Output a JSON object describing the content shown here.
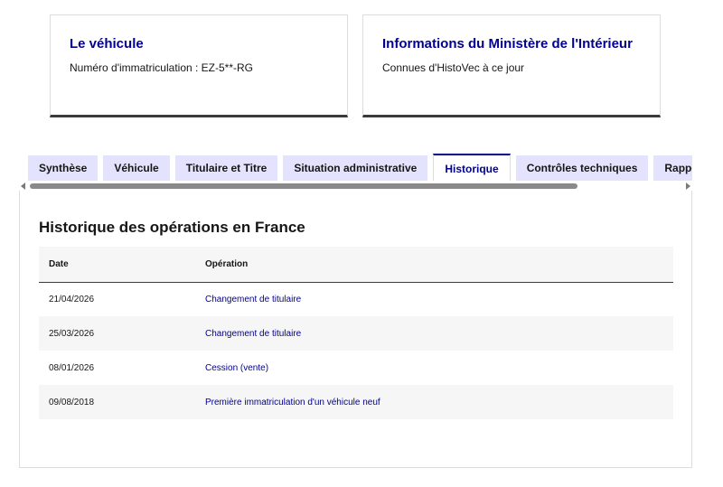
{
  "cards": [
    {
      "title": "Le véhicule",
      "subtitle": "Numéro d'immatriculation : EZ-5**-RG"
    },
    {
      "title": "Informations du Ministère de l'Intérieur",
      "subtitle": "Connues d'HistoVec à ce jour"
    }
  ],
  "tabs": [
    {
      "label": "Synthèse",
      "active": false
    },
    {
      "label": "Véhicule",
      "active": false
    },
    {
      "label": "Titulaire et Titre",
      "active": false
    },
    {
      "label": "Situation administrative",
      "active": false
    },
    {
      "label": "Historique",
      "active": true
    },
    {
      "label": "Contrôles techniques",
      "active": false
    },
    {
      "label": "Rappels constructeur",
      "active": false
    }
  ],
  "history": {
    "title": "Historique des opérations en France",
    "columns": [
      "Date",
      "Opération"
    ],
    "rows": [
      {
        "date": "21/04/2026",
        "operation": "Changement de titulaire"
      },
      {
        "date": "25/03/2026",
        "operation": "Changement de titulaire"
      },
      {
        "date": "08/01/2026",
        "operation": "Cession (vente)"
      },
      {
        "date": "09/08/2018",
        "operation": "Première immatriculation d'un véhicule neuf"
      }
    ]
  },
  "colors": {
    "primary": "#000091",
    "tab_bg": "#e3e3fd",
    "row_alt": "#f6f6f6"
  }
}
